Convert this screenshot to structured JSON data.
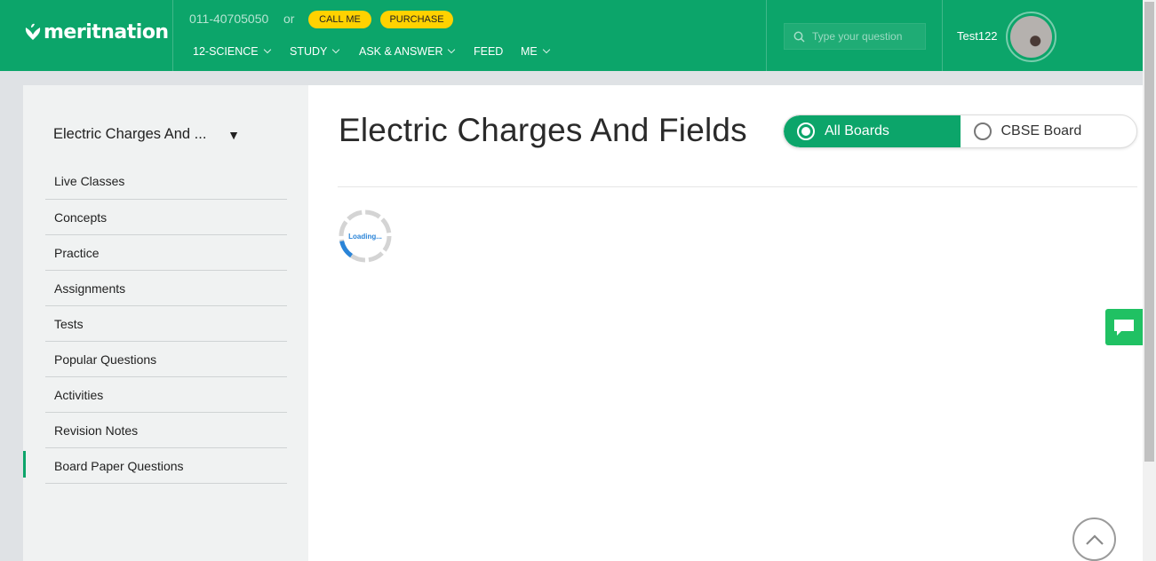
{
  "header": {
    "logo_text": "meritnation",
    "phone": "011-40705050",
    "or_text": "or",
    "call_me": "CALL ME",
    "purchase": "PURCHASE",
    "nav": [
      {
        "label": "12-SCIENCE",
        "dropdown": true
      },
      {
        "label": "STUDY",
        "dropdown": true
      },
      {
        "label": "ASK & ANSWER",
        "dropdown": true
      },
      {
        "label": "FEED",
        "dropdown": false
      },
      {
        "label": "ME",
        "dropdown": true
      }
    ],
    "search_placeholder": "Type your question",
    "username": "Test122"
  },
  "sidebar": {
    "chapter_select": "Electric Charges And ...",
    "items": [
      {
        "label": "Live Classes"
      },
      {
        "label": "Concepts"
      },
      {
        "label": "Practice"
      },
      {
        "label": "Assignments"
      },
      {
        "label": "Tests"
      },
      {
        "label": "Popular Questions"
      },
      {
        "label": "Activities"
      },
      {
        "label": "Revision Notes"
      },
      {
        "label": "Board Paper Questions",
        "active": true
      }
    ]
  },
  "main": {
    "title": "Electric Charges And Fields",
    "boards": [
      {
        "label": "All Boards",
        "selected": true
      },
      {
        "label": "CBSE Board",
        "selected": false
      }
    ],
    "loading_text": "Loading..."
  },
  "colors": {
    "brand_green": "#0ca56a",
    "accent_yellow": "#ffd200",
    "chat_green": "#20c163",
    "loader_blue": "#2a84d8"
  },
  "icons": [
    "meritnation-logo-icon",
    "search-icon",
    "chevron-down-icon",
    "dropdown-triangle-icon",
    "radio-icon",
    "loading-spinner-icon",
    "chat-icon",
    "scroll-top-icon"
  ]
}
